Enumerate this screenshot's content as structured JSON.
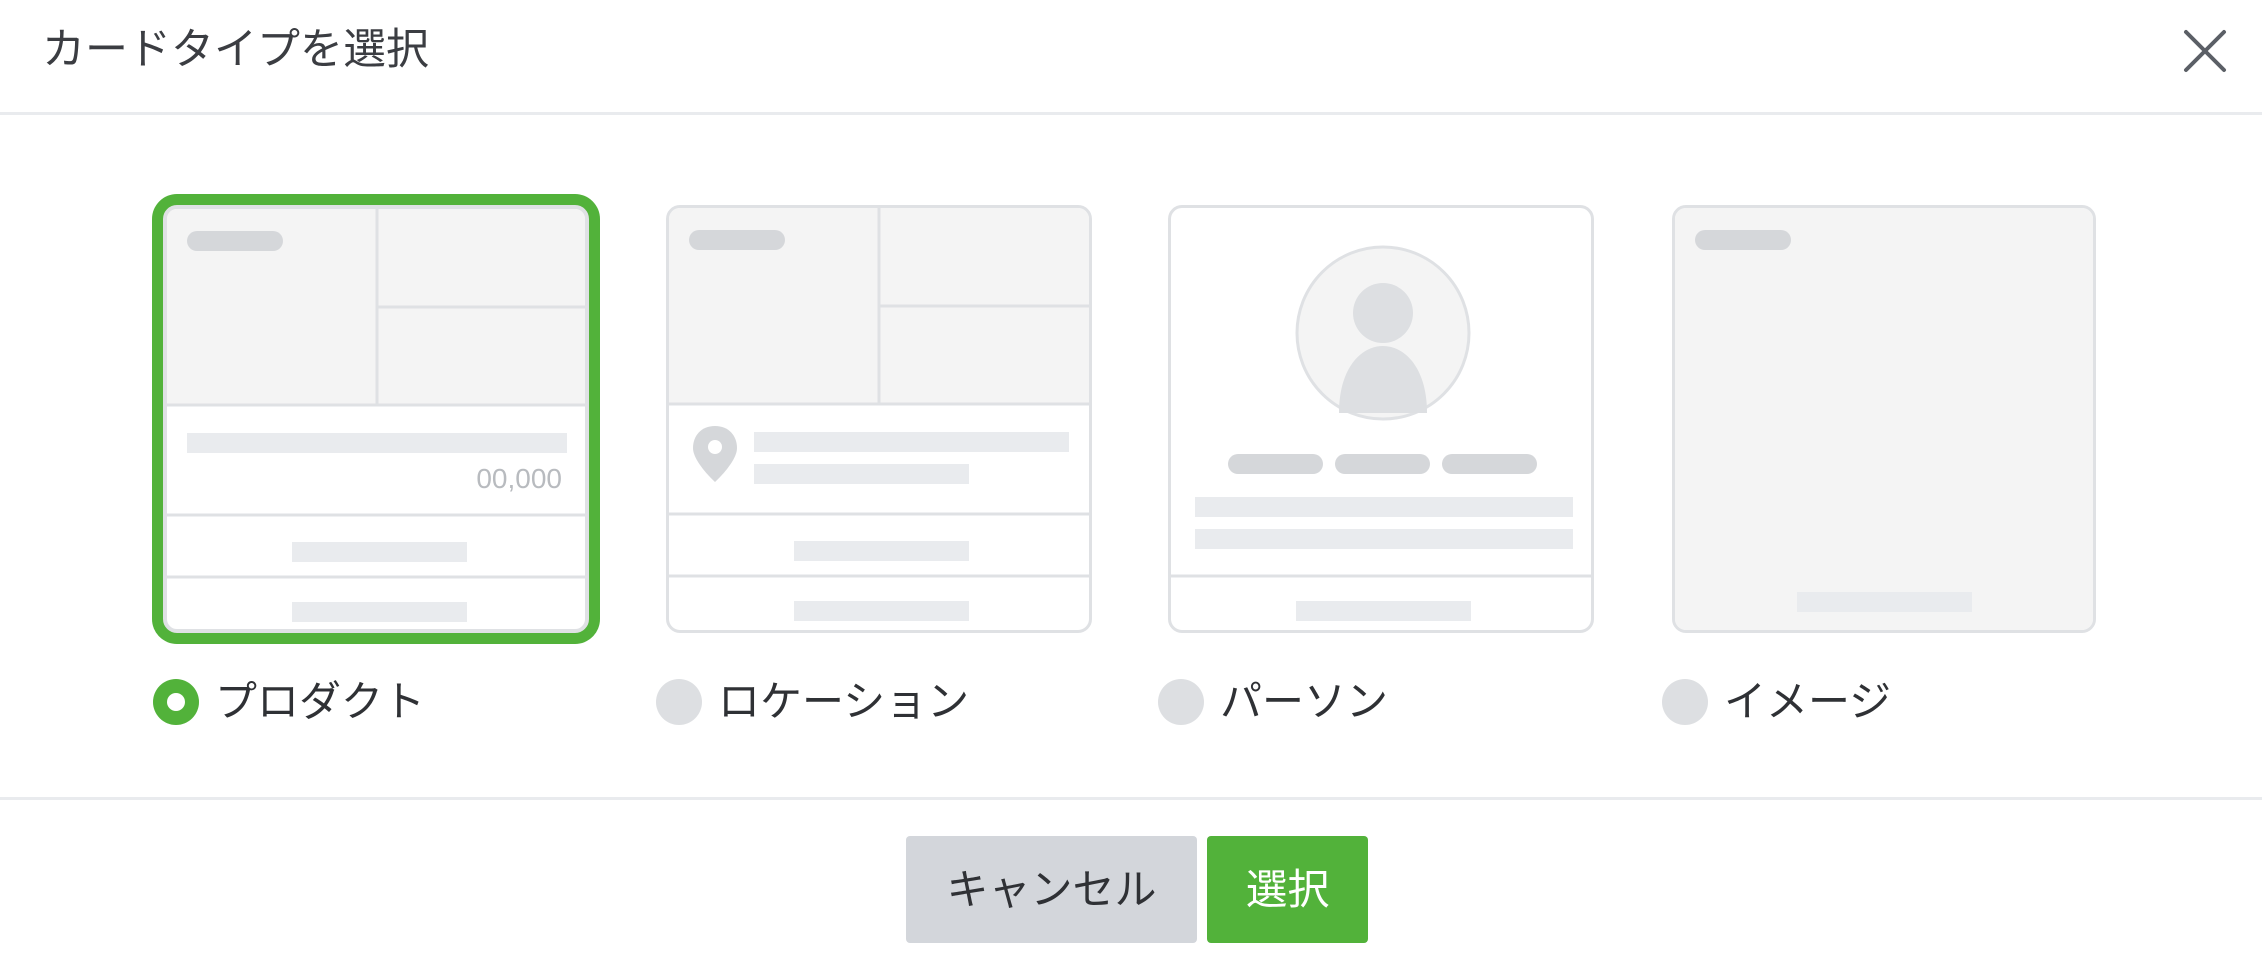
{
  "dialog": {
    "title": "カードタイプを選択",
    "close_icon": "close-icon"
  },
  "card_types": [
    {
      "id": "product",
      "label": "プロダクト",
      "selected": true,
      "price_placeholder": "00,000"
    },
    {
      "id": "location",
      "label": "ロケーション",
      "selected": false,
      "icon": "map-pin-icon"
    },
    {
      "id": "person",
      "label": "パーソン",
      "selected": false,
      "icon": "person-avatar-icon"
    },
    {
      "id": "image",
      "label": "イメージ",
      "selected": false
    }
  ],
  "footer": {
    "cancel_label": "キャンセル",
    "select_label": "選択"
  },
  "colors": {
    "accent": "#52b23a",
    "placeholder": "#e9ebee",
    "border": "#dfe1e4"
  }
}
